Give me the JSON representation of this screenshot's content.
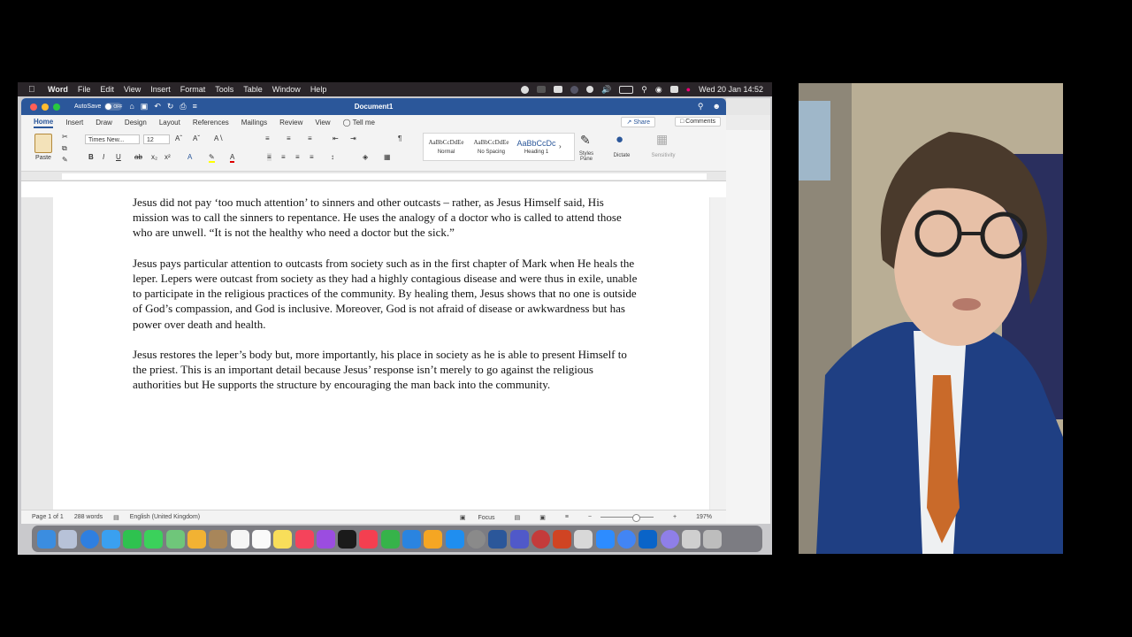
{
  "menubar": {
    "app_name": "Word",
    "items": [
      "File",
      "Edit",
      "View",
      "Insert",
      "Format",
      "Tools",
      "Table",
      "Window",
      "Help"
    ],
    "datetime": "Wed 20 Jan  14:52"
  },
  "titlebar": {
    "autosave_label": "AutoSave",
    "autosave_state": "OFF",
    "document_title": "Document1"
  },
  "ribbon_tabs": {
    "tabs": [
      "Home",
      "Insert",
      "Draw",
      "Design",
      "Layout",
      "References",
      "Mailings",
      "Review",
      "View"
    ],
    "tell_me": "Tell me",
    "share_label": "Share",
    "comments_label": "Comments"
  },
  "ribbon": {
    "paste_label": "Paste",
    "font_name": "Times New...",
    "font_size": "12",
    "styles": [
      {
        "preview": "AaBbCcDdEe",
        "name": "Normal"
      },
      {
        "preview": "AaBbCcDdEe",
        "name": "No Spacing"
      },
      {
        "preview": "AaBbCcDc",
        "name": "Heading 1"
      }
    ],
    "styles_pane_label": "Styles Pane",
    "dictate_label": "Dictate",
    "sensitivity_label": "Sensitivity"
  },
  "document": {
    "paragraphs": [
      "Jesus did not pay ‘too much attention’ to sinners and other outcasts – rather, as Jesus Himself said, His mission was to call the sinners to repentance.  He uses the analogy of a doctor who is called to attend those who are unwell.  “It is not the healthy who need a doctor but the sick.”",
      "Jesus pays particular attention to outcasts from society such as in the first chapter of Mark when He heals the leper.  Lepers were outcast from society as they had a highly contagious disease and were thus in exile, unable to participate in the religious practices of the community.  By healing them, Jesus shows that no one is outside of God’s compassion, and God is inclusive.  Moreover, God is not afraid of disease or awkwardness but has power over death and health.",
      "Jesus restores the leper’s body but, more importantly, his place in society as he is able to present Himself to the priest. This is an important detail because Jesus’ response isn’t merely to go against the religious authorities but He supports the structure by encouraging the man back into the community."
    ]
  },
  "statusbar": {
    "page": "Page 1 of 1",
    "words": "288 words",
    "language": "English (United Kingdom)",
    "focus_label": "Focus",
    "zoom": "197%"
  },
  "colors": {
    "word_blue": "#2b579a",
    "menubar_bg": "#2a2529"
  }
}
